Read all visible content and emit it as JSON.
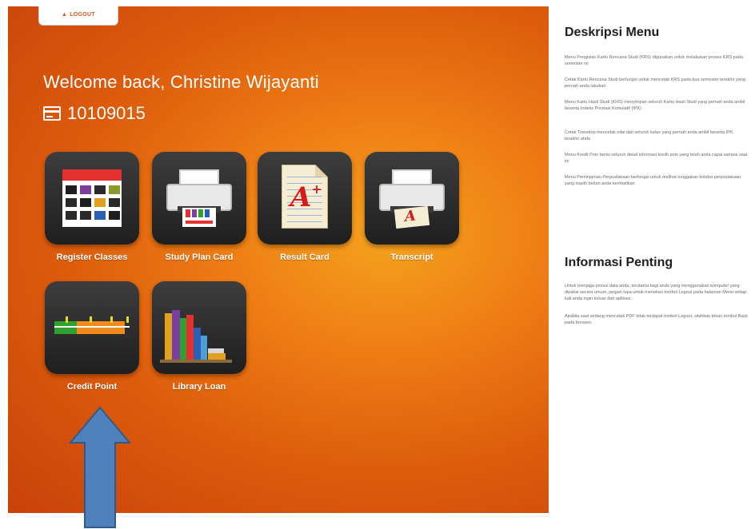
{
  "header": {
    "logout_label": "LOGOUT",
    "welcome_text": "Welcome back, Christine Wijayanti",
    "student_id": "10109015"
  },
  "menu": {
    "tiles": [
      {
        "label": "Register Classes",
        "icon": "calendar-grid-icon"
      },
      {
        "label": "Study Plan Card",
        "icon": "printer-icon"
      },
      {
        "label": "Result Card",
        "icon": "grade-document-icon"
      },
      {
        "label": "Transcript",
        "icon": "printer-transcript-icon"
      },
      {
        "label": "Credit Point",
        "icon": "ruler-progress-icon"
      },
      {
        "label": "Library Loan",
        "icon": "books-icon"
      }
    ]
  },
  "sidebar": {
    "menu_title": "Deskripsi Menu",
    "menu_paragraphs": [
      "Menu Pengisian Kartu Rencana Studi (KRS) digunakan untuk melakukan proses KRS pada semester ini",
      "Cetak Kartu Rencana Studi berfungsi untuk mencetak KRS pada dua semester terakhir yang pernah anda lakukan",
      "Menu Kartu Hasil Studi (KHS) menyimpan seluruh Kartu Hasil Studi yang pernah anda ambil beserta Indeks Prestasi Kumulatif (IPK)",
      "Cetak Transkrip mencetak nilai dari seluruh kelas yang pernah anda ambil beserta IPK terakhir anda",
      "Menu Kredit Poin berisi seluruh detail informasi kredit poin yang telah anda capai sampai saat ini",
      "Menu Peminjaman Perpustakaan berfungsi untuk melihat tunggakan koleksi perpustakaan yang masih belum anda kembalikan"
    ],
    "info_title": "Informasi Penting",
    "info_paragraphs": [
      "Untuk menjaga privasi data anda, terutama bagi anda yang menggunakan komputer yang dipakai secara umum, jangan lupa untuk menekan tombol Logout pada halaman Menu setiap kali anda ingin keluar dari aplikasi.",
      "Apabila saat sedang mencetak PDF tidak terdapat tombol Logout, silahkan tekan tombol Back pada browser."
    ]
  },
  "colors": {
    "panel_orange": "#e0620e",
    "tile_dark": "#2a2a2a",
    "arrow_blue": "#4f81bd"
  }
}
